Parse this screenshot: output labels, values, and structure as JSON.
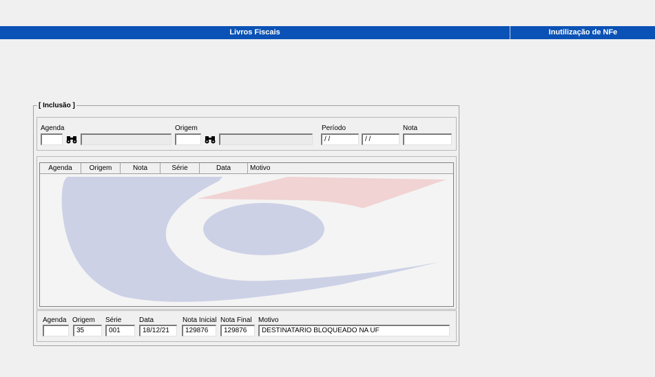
{
  "titlebar": {
    "main_title": "Livros Fiscais",
    "side_title": "Inutilização de NFe",
    "color": "#0a52b5"
  },
  "group": {
    "title": "[ Inclusão ]"
  },
  "filter": {
    "agenda_label": "Agenda",
    "agenda_value": "",
    "agenda_desc": "",
    "origem_label": "Origem",
    "origem_value": "",
    "origem_desc": "",
    "periodo_label": "Período",
    "periodo_start": "/ /",
    "periodo_end": "/ /",
    "nota_label": "Nota",
    "nota_value": "",
    "search_icon": "binoculars-icon"
  },
  "grid": {
    "columns": [
      "Agenda",
      "Origem",
      "Nota",
      "Série",
      "Data",
      "Motivo"
    ],
    "rows": []
  },
  "form": {
    "agenda_label": "Agenda",
    "agenda_value": "",
    "origem_label": "Origem",
    "origem_value": "35",
    "serie_label": "Série",
    "serie_value": "001",
    "data_label": "Data",
    "data_value": "18/12/21",
    "nota_inicial_label": "Nota Inicial",
    "nota_inicial_value": "129876",
    "nota_final_label": "Nota Final",
    "nota_final_value": "129876",
    "motivo_label": "Motivo",
    "motivo_value": "DESTINATARIO BLOQUEADO NA UF"
  }
}
